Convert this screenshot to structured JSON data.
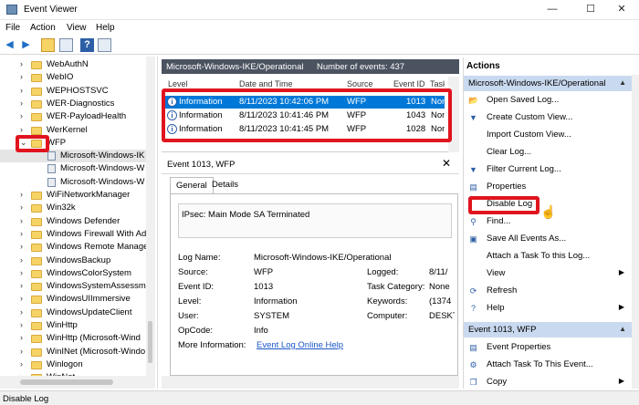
{
  "window": {
    "title": "Event Viewer",
    "minimize": "—",
    "maximize": "☐",
    "close": "✕"
  },
  "menu": [
    {
      "label": "File",
      "key": "F"
    },
    {
      "label": "Action",
      "key": "A"
    },
    {
      "label": "View",
      "key": "V"
    },
    {
      "label": "Help",
      "key": "H"
    }
  ],
  "tree": {
    "items": [
      {
        "label": "WebAuthN",
        "type": "folder",
        "expander": "›"
      },
      {
        "label": "WebIO",
        "type": "folder",
        "expander": "›"
      },
      {
        "label": "WEPHOSTSVC",
        "type": "folder",
        "expander": "›"
      },
      {
        "label": "WER-Diagnostics",
        "type": "folder",
        "expander": "›"
      },
      {
        "label": "WER-PayloadHealth",
        "type": "folder",
        "expander": "›"
      },
      {
        "label": "WerKernel",
        "type": "folder",
        "expander": "›"
      },
      {
        "label": "WFP",
        "type": "folder",
        "expander": "⌄"
      },
      {
        "label": "Microsoft-Windows-IK",
        "type": "log"
      },
      {
        "label": "Microsoft-Windows-W",
        "type": "log"
      },
      {
        "label": "Microsoft-Windows-W",
        "type": "log"
      },
      {
        "label": "WiFiNetworkManager",
        "type": "folder",
        "expander": "›"
      },
      {
        "label": "Win32k",
        "type": "folder",
        "expander": "›"
      },
      {
        "label": "Windows Defender",
        "type": "folder",
        "expander": "›"
      },
      {
        "label": "Windows Firewall With Ad",
        "type": "folder",
        "expander": "›"
      },
      {
        "label": "Windows Remote Manage",
        "type": "folder",
        "expander": "›"
      },
      {
        "label": "WindowsBackup",
        "type": "folder",
        "expander": "›"
      },
      {
        "label": "WindowsColorSystem",
        "type": "folder",
        "expander": "›"
      },
      {
        "label": "WindowsSystemAssessme",
        "type": "folder",
        "expander": "›"
      },
      {
        "label": "WindowsUIImmersive",
        "type": "folder",
        "expander": "›"
      },
      {
        "label": "WindowsUpdateClient",
        "type": "folder",
        "expander": "›"
      },
      {
        "label": "WinHttp",
        "type": "folder",
        "expander": "›"
      },
      {
        "label": "WinHttp (Microsoft-Wind",
        "type": "folder",
        "expander": "›"
      },
      {
        "label": "WinINet (Microsoft-Windo",
        "type": "folder",
        "expander": "›"
      },
      {
        "label": "Winlogon",
        "type": "folder",
        "expander": "›"
      },
      {
        "label": "WinNat",
        "type": "folder",
        "expander": "›"
      }
    ]
  },
  "events": {
    "log_name": "Microsoft-Windows-IKE/Operational",
    "count_label": "Number of events: 437",
    "columns": [
      "Level",
      "Date and Time",
      "Source",
      "Event ID",
      "Task"
    ],
    "rows": [
      {
        "level": "Information",
        "datetime": "8/11/2023 10:42:06 PM",
        "source": "WFP",
        "event_id": "1013",
        "task": "Non"
      },
      {
        "level": "Information",
        "datetime": "8/11/2023 10:41:46 PM",
        "source": "WFP",
        "event_id": "1043",
        "task": "Non"
      },
      {
        "level": "Information",
        "datetime": "8/11/2023 10:41:45 PM",
        "source": "WFP",
        "event_id": "1028",
        "task": "Non"
      }
    ]
  },
  "detail": {
    "title": "Event 1013, WFP",
    "close": "✕",
    "tabs": [
      "General",
      "Details"
    ],
    "message": "IPsec: Main Mode SA Terminated",
    "labels": {
      "log_name": "Log Name:",
      "source": "Source:",
      "event_id": "Event ID:",
      "level": "Level:",
      "user": "User:",
      "opcode": "OpCode:",
      "more_info": "More Information:",
      "logged": "Logged:",
      "task_category": "Task Category:",
      "keywords": "Keywords:",
      "computer": "Computer:"
    },
    "values": {
      "log_name": "Microsoft-Windows-IKE/Operational",
      "source": "WFP",
      "event_id": "1013",
      "level": "Information",
      "user": "SYSTEM",
      "opcode": "Info",
      "more_info": "Event Log Online Help",
      "logged": "8/11/",
      "task_category": "None",
      "keywords": "(1374",
      "computer": "DESKT"
    }
  },
  "actions": {
    "title": "Actions",
    "section1": "Microsoft-Windows-IKE/Operational",
    "items1": [
      {
        "label": "Open Saved Log...",
        "icon": "folder-open-icon",
        "glyph": "📂"
      },
      {
        "label": "Create Custom View...",
        "icon": "filter-create-icon",
        "glyph": "▼"
      },
      {
        "label": "Import Custom View...",
        "icon": "",
        "glyph": ""
      },
      {
        "label": "Clear Log...",
        "icon": "",
        "glyph": ""
      },
      {
        "label": "Filter Current Log...",
        "icon": "filter-icon",
        "glyph": "▼"
      },
      {
        "label": "Properties",
        "icon": "properties-icon",
        "glyph": "▤"
      },
      {
        "label": "Disable Log",
        "icon": "",
        "glyph": ""
      },
      {
        "label": "Find...",
        "icon": "binoculars-icon",
        "glyph": "⚲"
      },
      {
        "label": "Save All Events As...",
        "icon": "save-icon",
        "glyph": "▣"
      },
      {
        "label": "Attach a Task To this Log...",
        "icon": "",
        "glyph": ""
      },
      {
        "label": "View",
        "icon": "",
        "glyph": "",
        "arrow": "▶"
      },
      {
        "label": "Refresh",
        "icon": "refresh-icon",
        "glyph": "⟳"
      },
      {
        "label": "Help",
        "icon": "help-icon",
        "glyph": "?",
        "arrow": "▶"
      }
    ],
    "section2": "Event 1013, WFP",
    "items2": [
      {
        "label": "Event Properties",
        "icon": "event-properties-icon",
        "glyph": "▤"
      },
      {
        "label": "Attach Task To This Event...",
        "icon": "attach-task-icon",
        "glyph": "⚙"
      },
      {
        "label": "Copy",
        "icon": "copy-icon",
        "glyph": "❐",
        "arrow": "▶"
      }
    ],
    "collapse": "▲"
  },
  "status": {
    "text": "Disable Log"
  },
  "colors": {
    "selection": "#0078d7",
    "highlight": "#e0141e",
    "section": "#c9d9ef",
    "pane_header": "#4b5361"
  }
}
